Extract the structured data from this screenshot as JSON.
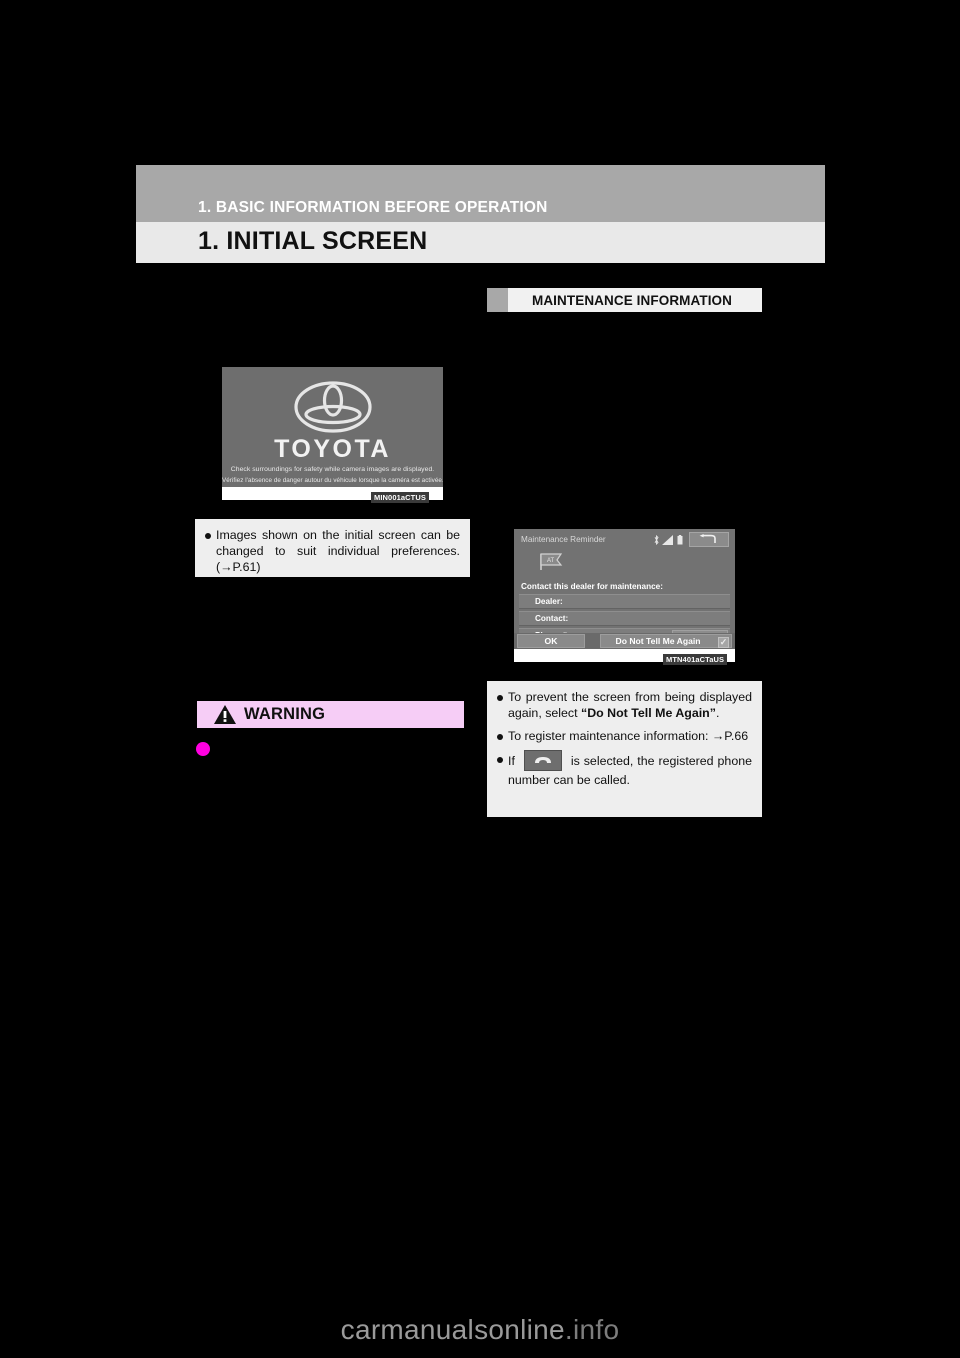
{
  "header": {
    "chapter": "1. BASIC INFORMATION BEFORE OPERATION",
    "title": "1. INITIAL SCREEN"
  },
  "sections": {
    "maintenance_information": "MAINTENANCE INFORMATION"
  },
  "figures": {
    "splash": {
      "wordmark": "TOYOTA",
      "caption_en": "Check surroundings for safety while camera images are displayed.",
      "caption_fr": "Vérifiez l'absence de danger autour du véhicule lorsque la caméra est activée.",
      "code": "MIN001aCTUS"
    },
    "maintenance": {
      "screen_title": "Maintenance Reminder",
      "prompt": "Contact this dealer for maintenance:",
      "rows": [
        {
          "label": "Dealer:"
        },
        {
          "label": "Contact:"
        },
        {
          "label": "Phone #:"
        }
      ],
      "ok_label": "OK",
      "do_not_tell_label": "Do Not Tell Me Again",
      "checkbox_glyph": "✓",
      "code": "MTN401aCTaUS"
    }
  },
  "left_notes": [
    {
      "parts": [
        {
          "t": "Images shown on the initial screen can be changed to suit individual preferences. (→P.61)",
          "bold": false
        }
      ]
    }
  ],
  "warning": {
    "label": "WARNING",
    "banner_color": "#f6cdf6",
    "bullet_color": "#ff00e0"
  },
  "right_notes": [
    {
      "parts": [
        {
          "t": "To prevent the screen from being displayed again, select ",
          "bold": false
        },
        {
          "t": "“Do Not Tell Me Again”",
          "bold": true
        },
        {
          "t": ".",
          "bold": false
        }
      ]
    },
    {
      "parts": [
        {
          "t": "To register maintenance information: →P.66",
          "bold": false
        }
      ]
    },
    {
      "parts": [
        {
          "t": "If ",
          "bold": false
        },
        {
          "icon": "phone-key-icon"
        },
        {
          "t": " is selected, the registered phone number can be called.",
          "bold": false
        }
      ]
    }
  ],
  "watermark": {
    "name": "carmanualsonline",
    "tld": ".info"
  }
}
